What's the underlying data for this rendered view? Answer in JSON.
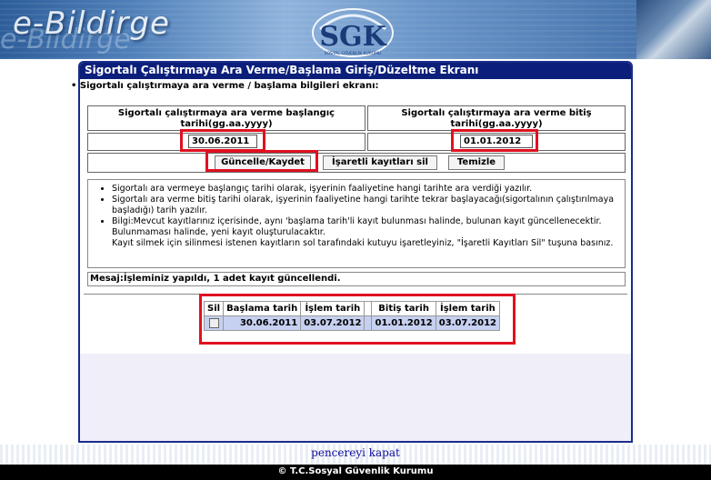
{
  "header": {
    "logo_text": "e-Bildirge",
    "emblem_text": "SGK",
    "emblem_subtext": "SOSYAL GÜVENLİK KURUMU"
  },
  "window": {
    "title": "Sigortalı Çalıştırmaya Ara Verme/Başlama Giriş/Düzeltme Ekranı",
    "subtitle": "• Sigortalı çalıştırmaya ara verme / başlama bilgileri ekranı:"
  },
  "form": {
    "start_label": "Sigortalı çalıştırmaya ara verme başlangıç tarihi(gg.aa.yyyy)",
    "end_label": "Sigortalı çalıştırmaya ara verme bitiş tarihi(gg.aa.yyyy)",
    "start_value": "30.06.2011",
    "end_value": "01.01.2012"
  },
  "buttons": {
    "update": "Güncelle/Kaydet",
    "delete_marked": "İşaretli kayıtları sil",
    "clear": "Temizle"
  },
  "info": {
    "items": [
      "Sigortalı ara vermeye başlangıç tarihi olarak, işyerinin faaliyetine hangi tarihte ara verdiği yazılır.",
      "Sigortalı ara verme bitiş tarihi olarak, işyerinin faaliyetine hangi tarihte tekrar başlayacağı(sigortalının çalıştırılmaya başladığı) tarih yazılır.",
      "Bilgi:Mevcut kayıtlarınız içerisinde, aynı 'başlama tarih'li kayıt bulunması halinde, bulunan kayıt güncellenecektir. Bulunmaması halinde, yeni kayıt oluşturulacaktır."
    ],
    "note": "Kayıt silmek için silinmesi istenen kayıtların sol tarafındaki kutuyu işaretleyiniz, \"İşaretli Kayıtları Sil\" tuşuna basınız."
  },
  "message": "Mesaj:İşleminiz yapıldı, 1 adet kayıt güncellendi.",
  "records": {
    "headers": [
      "Sil",
      "Başlama tarih",
      "İşlem tarih",
      "",
      "Bitiş tarih",
      "İşlem tarih"
    ],
    "rows": [
      {
        "start": "30.06.2011",
        "start_processed": "03.07.2012",
        "end": "01.01.2012",
        "end_processed": "03.07.2012"
      }
    ]
  },
  "footer": {
    "close_link": "pencereyi kapat",
    "copyright": "© T.C.Sosyal Güvenlik Kurumu"
  }
}
